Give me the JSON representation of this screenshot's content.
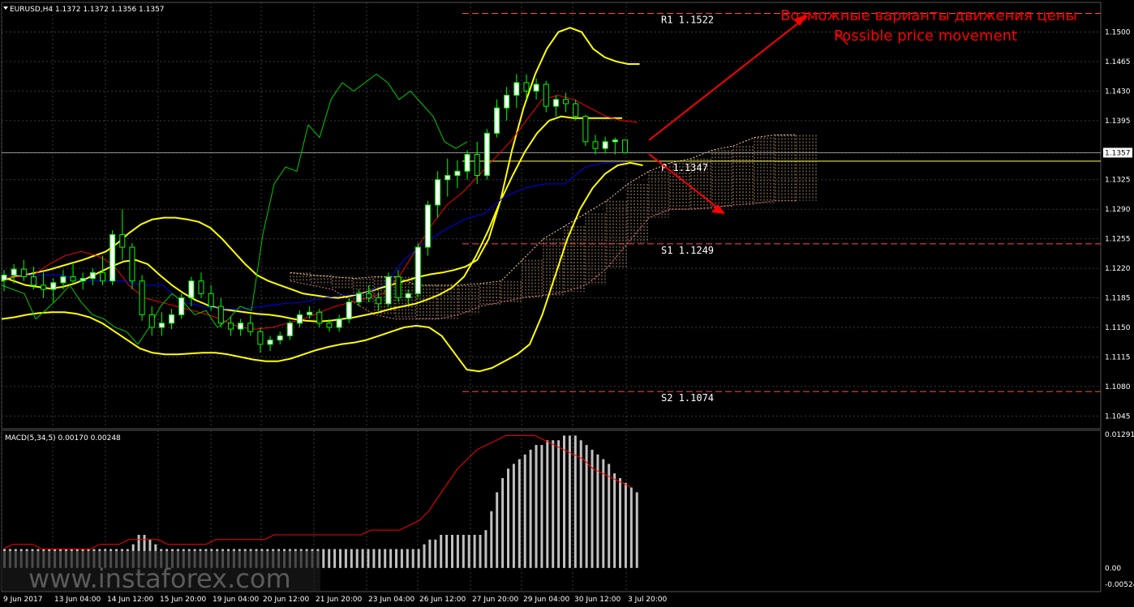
{
  "colors": {
    "background": "#000000",
    "grid": "#3a3a3a",
    "bull_candle": "#ffffff",
    "bear_candle": "#000000",
    "candle_outline": "#00ff00",
    "bollinger": "#ffff00",
    "tenkan": "#ff0000",
    "kijun": "#0000ff",
    "chikou": "#00cc00",
    "cloud": "#ffcc99",
    "levels": "#ff4b4b",
    "pivot": "#ffff66",
    "arrow": "#ff0000",
    "macd_hist": "#c0c0c0",
    "macd_signal": "#ff0000",
    "current_price_box": "#ffffff"
  },
  "chart_data": [
    {
      "type": "candlestick",
      "symbol_header": "EURUSD,H4  1.1372 1.1372 1.1356 1.1357",
      "ylim": [
        1.103,
        1.1535
      ],
      "y_ticks": [
        1.15,
        1.1465,
        1.143,
        1.1395,
        1.1357,
        1.1325,
        1.129,
        1.1255,
        1.122,
        1.1185,
        1.115,
        1.1115,
        1.108,
        1.1045
      ],
      "current_price": "1.1357",
      "x_ticks": [
        "9 Jun 2017",
        "13 Jun 04:00",
        "14 Jun 12:00",
        "15 Jun 20:00",
        "19 Jun 04:00",
        "20 Jun 12:00",
        "21 Jun 20:00",
        "23 Jun 04:00",
        "26 Jun 12:00",
        "27 Jun 20:00",
        "29 Jun 04:00",
        "30 Jun 12:00",
        "3 Jul 20:00"
      ],
      "candles": [
        [
          1.1206,
          1.1218,
          1.1193,
          1.1212
        ],
        [
          1.1212,
          1.1225,
          1.1202,
          1.1219
        ],
        [
          1.1219,
          1.123,
          1.1205,
          1.121
        ],
        [
          1.121,
          1.1222,
          1.1195,
          1.12
        ],
        [
          1.12,
          1.1215,
          1.1185,
          1.1195
        ],
        [
          1.1195,
          1.1208,
          1.118,
          1.1203
        ],
        [
          1.1203,
          1.1218,
          1.1195,
          1.121
        ],
        [
          1.121,
          1.1225,
          1.1203,
          1.1205
        ],
        [
          1.1205,
          1.1215,
          1.1195,
          1.1208
        ],
        [
          1.1208,
          1.122,
          1.12,
          1.1215
        ],
        [
          1.1215,
          1.1235,
          1.12,
          1.1205
        ],
        [
          1.1205,
          1.1265,
          1.12,
          1.126
        ],
        [
          1.126,
          1.129,
          1.123,
          1.1245
        ],
        [
          1.1245,
          1.125,
          1.1195,
          1.1205
        ],
        [
          1.1205,
          1.1212,
          1.1158,
          1.1165
        ],
        [
          1.1165,
          1.1175,
          1.114,
          1.115
        ],
        [
          1.115,
          1.1168,
          1.114,
          1.1155
        ],
        [
          1.1155,
          1.1172,
          1.1148,
          1.1165
        ],
        [
          1.1165,
          1.119,
          1.116,
          1.1185
        ],
        [
          1.1185,
          1.121,
          1.1175,
          1.1205
        ],
        [
          1.1205,
          1.1215,
          1.1185,
          1.119
        ],
        [
          1.119,
          1.12,
          1.117,
          1.1175
        ],
        [
          1.1175,
          1.1185,
          1.115,
          1.1155
        ],
        [
          1.1155,
          1.1162,
          1.114,
          1.1148
        ],
        [
          1.1148,
          1.116,
          1.114,
          1.1155
        ],
        [
          1.1155,
          1.1165,
          1.114,
          1.1145
        ],
        [
          1.1145,
          1.115,
          1.112,
          1.113
        ],
        [
          1.113,
          1.114,
          1.1122,
          1.1135
        ],
        [
          1.1135,
          1.1145,
          1.113,
          1.114
        ],
        [
          1.114,
          1.1158,
          1.1135,
          1.1155
        ],
        [
          1.1155,
          1.117,
          1.115,
          1.1165
        ],
        [
          1.1165,
          1.1175,
          1.116,
          1.1168
        ],
        [
          1.1168,
          1.1172,
          1.115,
          1.1155
        ],
        [
          1.1155,
          1.116,
          1.1145,
          1.115
        ],
        [
          1.115,
          1.1165,
          1.1145,
          1.116
        ],
        [
          1.116,
          1.1185,
          1.1155,
          1.118
        ],
        [
          1.118,
          1.1195,
          1.1175,
          1.119
        ],
        [
          1.119,
          1.12,
          1.118,
          1.1185
        ],
        [
          1.1185,
          1.1192,
          1.117,
          1.1178
        ],
        [
          1.1178,
          1.1215,
          1.1175,
          1.121
        ],
        [
          1.121,
          1.1218,
          1.118,
          1.1185
        ],
        [
          1.1185,
          1.1195,
          1.1178,
          1.119
        ],
        [
          1.119,
          1.125,
          1.1185,
          1.1245
        ],
        [
          1.1245,
          1.13,
          1.1235,
          1.1295
        ],
        [
          1.1295,
          1.1335,
          1.128,
          1.1325
        ],
        [
          1.1325,
          1.135,
          1.1305,
          1.133
        ],
        [
          1.133,
          1.1348,
          1.1315,
          1.1335
        ],
        [
          1.1335,
          1.136,
          1.1325,
          1.1355
        ],
        [
          1.1355,
          1.137,
          1.132,
          1.133
        ],
        [
          1.133,
          1.1385,
          1.1325,
          1.138
        ],
        [
          1.138,
          1.142,
          1.1375,
          1.141
        ],
        [
          1.141,
          1.1435,
          1.1395,
          1.1425
        ],
        [
          1.1425,
          1.145,
          1.141,
          1.144
        ],
        [
          1.144,
          1.145,
          1.142,
          1.143
        ],
        [
          1.143,
          1.1445,
          1.142,
          1.1438
        ],
        [
          1.1438,
          1.1442,
          1.1405,
          1.1412
        ],
        [
          1.1412,
          1.1425,
          1.14,
          1.142
        ],
        [
          1.142,
          1.1428,
          1.1405,
          1.1415
        ],
        [
          1.1415,
          1.142,
          1.1395,
          1.14
        ],
        [
          1.14,
          1.1402,
          1.1365,
          1.137
        ],
        [
          1.137,
          1.1378,
          1.1355,
          1.1362
        ],
        [
          1.1362,
          1.1376,
          1.1356,
          1.137
        ],
        [
          1.137,
          1.1375,
          1.1355,
          1.1372
        ],
        [
          1.1372,
          1.1372,
          1.1356,
          1.1357
        ]
      ],
      "bollinger_upper": [
        1.1205,
        1.121,
        1.1212,
        1.1215,
        1.1218,
        1.1222,
        1.1226,
        1.123,
        1.1235,
        1.124,
        1.125,
        1.1262,
        1.1272,
        1.1278,
        1.128,
        1.128,
        1.1278,
        1.1275,
        1.1268,
        1.1255,
        1.124,
        1.1225,
        1.1212,
        1.1205,
        1.12,
        1.1195,
        1.119,
        1.1188,
        1.1186,
        1.1185,
        1.1187,
        1.119,
        1.1194,
        1.1198,
        1.1202,
        1.1206,
        1.121,
        1.1213,
        1.1215,
        1.1218,
        1.1222,
        1.123,
        1.1255,
        1.13,
        1.136,
        1.141,
        1.145,
        1.148,
        1.15,
        1.1505,
        1.15,
        1.148,
        1.147,
        1.1465,
        1.1462,
        1.1462
      ],
      "bollinger_middle": [
        1.121,
        1.1205,
        1.12,
        1.1198,
        1.1196,
        1.1198,
        1.1202,
        1.1208,
        1.1215,
        1.1222,
        1.1228,
        1.123,
        1.1225,
        1.1212,
        1.12,
        1.119,
        1.1182,
        1.1176,
        1.1172,
        1.117,
        1.1168,
        1.1166,
        1.1165,
        1.1163,
        1.116,
        1.1158,
        1.1157,
        1.1158,
        1.116,
        1.1162,
        1.1165,
        1.1168,
        1.1172,
        1.1175,
        1.1178,
        1.1183,
        1.1189,
        1.1197,
        1.121,
        1.1235,
        1.1265,
        1.13,
        1.133,
        1.1358,
        1.138,
        1.1395,
        1.14,
        1.1398,
        1.1398,
        1.1398,
        1.1398,
        1.1398
      ],
      "bollinger_lower": [
        1.116,
        1.1162,
        1.1165,
        1.1167,
        1.1168,
        1.1168,
        1.1166,
        1.1162,
        1.1155,
        1.1145,
        1.1135,
        1.1125,
        1.112,
        1.1118,
        1.1118,
        1.1119,
        1.112,
        1.112,
        1.1118,
        1.1115,
        1.1112,
        1.111,
        1.111,
        1.1113,
        1.1118,
        1.1123,
        1.1127,
        1.113,
        1.1132,
        1.1135,
        1.114,
        1.1145,
        1.115,
        1.1152,
        1.115,
        1.114,
        1.112,
        1.11,
        1.1098,
        1.1102,
        1.111,
        1.1118,
        1.113,
        1.1165,
        1.121,
        1.1255,
        1.129,
        1.1315,
        1.1332,
        1.1342,
        1.1345,
        1.1342
      ],
      "ichimoku_tenkan": [
        1.1208,
        1.121,
        1.1212,
        1.1225,
        1.1235,
        1.124,
        1.1235,
        1.1225,
        1.12,
        1.1185,
        1.118,
        1.1175,
        1.117,
        1.1165,
        1.1158,
        1.115,
        1.1148,
        1.115,
        1.1155,
        1.116,
        1.1168,
        1.1175,
        1.118,
        1.1185,
        1.119,
        1.121,
        1.124,
        1.127,
        1.1295,
        1.131,
        1.133,
        1.135,
        1.137,
        1.1395,
        1.142,
        1.1425,
        1.142,
        1.141,
        1.14,
        1.1395,
        1.1393
      ],
      "ichimoku_kijun": [
        1.1212,
        1.1212,
        1.1212,
        1.1212,
        1.1205,
        1.1205,
        1.1205,
        1.12,
        1.12,
        1.118,
        1.1175,
        1.1172,
        1.1172,
        1.1175,
        1.1178,
        1.118,
        1.1185,
        1.1188,
        1.119,
        1.12,
        1.123,
        1.125,
        1.1265,
        1.1278,
        1.1285,
        1.1305,
        1.1315,
        1.132,
        1.132,
        1.134,
        1.1345,
        1.1345
      ],
      "chikou_span": [
        1.12,
        1.1195,
        1.119,
        1.116,
        1.1172,
        1.1185,
        1.12,
        1.118,
        1.1165,
        1.116,
        1.115,
        1.1145,
        1.113,
        1.115,
        1.1175,
        1.119,
        1.118,
        1.1165,
        1.117,
        1.115,
        1.116,
        1.1175,
        1.117,
        1.126,
        1.132,
        1.134,
        1.1335,
        1.139,
        1.1375,
        1.142,
        1.144,
        1.143,
        1.144,
        1.145,
        1.144,
        1.142,
        1.143,
        1.1415,
        1.14,
        1.137,
        1.1362,
        1.137
      ],
      "cloud": [
        [
          1.1215,
          1.1205
        ],
        [
          1.1212,
          1.12
        ],
        [
          1.121,
          1.1195
        ],
        [
          1.1208,
          1.118
        ],
        [
          1.121,
          1.1165
        ],
        [
          1.121,
          1.116
        ],
        [
          1.12,
          1.116
        ],
        [
          1.12,
          1.116
        ],
        [
          1.12,
          1.1165
        ],
        [
          1.1202,
          1.1175
        ],
        [
          1.1205,
          1.118
        ],
        [
          1.123,
          1.1185
        ],
        [
          1.1255,
          1.1188
        ],
        [
          1.127,
          1.1192
        ],
        [
          1.1285,
          1.12
        ],
        [
          1.13,
          1.122
        ],
        [
          1.132,
          1.125
        ],
        [
          1.1335,
          1.128
        ],
        [
          1.1345,
          1.129
        ],
        [
          1.135,
          1.129
        ],
        [
          1.136,
          1.1292
        ],
        [
          1.1365,
          1.1295
        ],
        [
          1.1375,
          1.1297
        ],
        [
          1.1378,
          1.13
        ],
        [
          1.1378,
          1.13
        ]
      ],
      "levels": [
        {
          "name": "R1",
          "label": "R1  1.1522",
          "value": 1.1522
        },
        {
          "name": "P",
          "label": "P  1.1347",
          "value": 1.1347
        },
        {
          "name": "S1",
          "label": "S1  1.1249",
          "value": 1.1249
        },
        {
          "name": "S2",
          "label": "S2  1.1074",
          "value": 1.1074
        }
      ]
    },
    {
      "type": "bar",
      "indicator_header": "MACD(5,34,5) 0.00170 0.00248",
      "ylim": [
        -0.0005,
        0.00291
      ],
      "y_ticks": [
        "0.01291",
        "0.00",
        "-0.00524"
      ],
      "histogram": [
        0.0004,
        0.0004,
        0.0004,
        0.0004,
        0.0004,
        0.0004,
        0.0004,
        0.0004,
        0.0004,
        0.0004,
        0.0004,
        0.0004,
        0.0004,
        0.0004,
        0.0004,
        0.0004,
        0.0004,
        0.0004,
        0.0004,
        0.0004,
        0.0004,
        0.0004,
        0.0004,
        0.0005,
        0.0007,
        0.0007,
        0.0006,
        0.0005,
        0.0004,
        0.0004,
        0.0004,
        0.0004,
        0.0004,
        0.0004,
        0.0004,
        0.0004,
        0.0004,
        0.0004,
        0.0004,
        0.0004,
        0.0004,
        0.0004,
        0.0004,
        0.0004,
        0.0004,
        0.0004,
        0.0004,
        0.0004,
        0.0004,
        0.0004,
        0.0004,
        0.0004,
        0.0004,
        0.0004,
        0.0004,
        0.0004,
        0.0004,
        0.0004,
        0.0004,
        0.0004,
        0.0004,
        0.0004,
        0.0004,
        0.0004,
        0.0004,
        0.0004,
        0.0004,
        0.0004,
        0.0004,
        0.0004,
        0.0004,
        0.0004,
        0.0004,
        0.0004,
        0.0004,
        0.0005,
        0.0006,
        0.0006,
        0.0007,
        0.0007,
        0.0007,
        0.0007,
        0.0007,
        0.0007,
        0.0007,
        0.0007,
        0.0008,
        0.0012,
        0.0016,
        0.0019,
        0.0021,
        0.0022,
        0.0023,
        0.0024,
        0.0025,
        0.0026,
        0.0026,
        0.0027,
        0.0027,
        0.0027,
        0.0028,
        0.0028,
        0.0028,
        0.0027,
        0.0026,
        0.0025,
        0.0024,
        0.0023,
        0.0022,
        0.002,
        0.0019,
        0.0018,
        0.0017,
        0.0016
      ],
      "signal": [
        0.0004,
        0.0005,
        0.0005,
        0.0005,
        0.0004,
        0.0004,
        0.0004,
        0.0004,
        0.0004,
        0.0004,
        0.0005,
        0.0005,
        0.0005,
        0.0006,
        0.0006,
        0.0006,
        0.0006,
        0.0005,
        0.0005,
        0.0005,
        0.0005,
        0.0005,
        0.0006,
        0.0006,
        0.0006,
        0.0006,
        0.0006,
        0.0006,
        0.0007,
        0.0007,
        0.0007,
        0.0007,
        0.0007,
        0.0007,
        0.0007,
        0.0007,
        0.0007,
        0.0007,
        0.0008,
        0.0008,
        0.0008,
        0.0008,
        0.0009,
        0.001,
        0.0012,
        0.0015,
        0.0018,
        0.0021,
        0.0023,
        0.0025,
        0.0026,
        0.0027,
        0.0028,
        0.0028,
        0.0028,
        0.0028,
        0.0027,
        0.0026,
        0.0025,
        0.0024,
        0.0023,
        0.0021,
        0.002,
        0.0019,
        0.0018,
        0.0017
      ],
      "signal_x_range": [
        0,
        115
      ]
    }
  ],
  "annotation": {
    "ru": "Возможные варианты движения цены",
    "en": "Possible price movement"
  },
  "watermark": "www.instaforex.com"
}
